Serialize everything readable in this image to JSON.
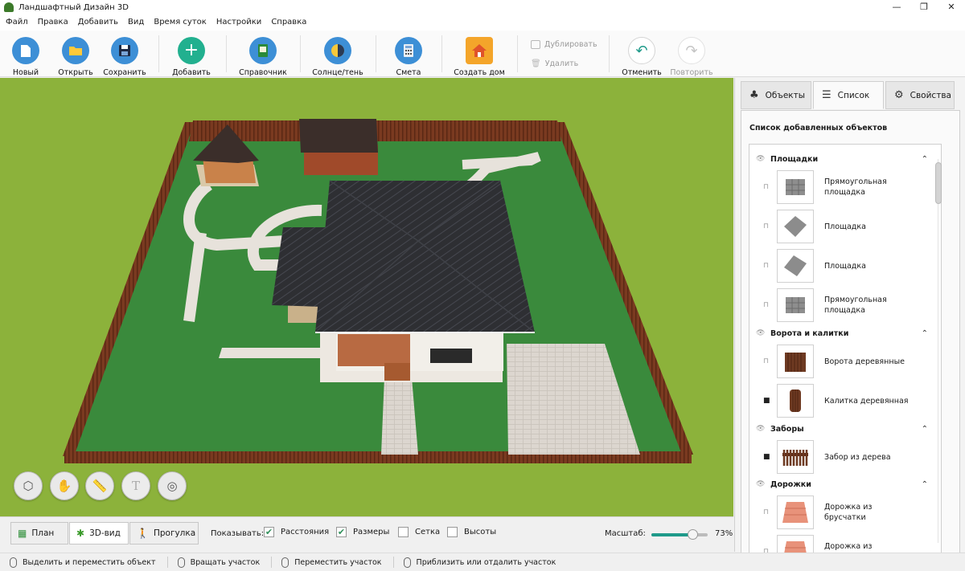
{
  "app": {
    "title": "Ландшафтный Дизайн 3D"
  },
  "window_controls": {
    "minimize": "—",
    "maximize": "❐",
    "close": "✕"
  },
  "menu": [
    "Файл",
    "Правка",
    "Добавить",
    "Вид",
    "Время суток",
    "Настройки",
    "Справка"
  ],
  "toolbar": {
    "new": "Новый",
    "open": "Открыть",
    "save": "Сохранить",
    "add": "Добавить",
    "reference": "Справочник",
    "sun": "Солнце/тень",
    "estimate": "Смета",
    "create_house": "Создать дом",
    "duplicate": "Дублировать",
    "delete": "Удалить",
    "undo": "Отменить",
    "redo": "Повторить"
  },
  "colors": {
    "accent": "#1f9a8a",
    "grass": "#3a8a3c",
    "fence": "#7a3a20",
    "roof": "#2e2f33",
    "path": "#e7e2db",
    "check": "#2f8f5a"
  },
  "view_tools": [
    "move-object-icon",
    "pan-hand-icon",
    "ruler-icon",
    "text-icon",
    "layers-icon"
  ],
  "right_panel": {
    "tabs": [
      {
        "label": "Объекты",
        "icon": "tree-icon"
      },
      {
        "label": "Список",
        "icon": "layers-icon"
      },
      {
        "label": "Свойства",
        "icon": "gear-icon"
      }
    ],
    "active_tab": "Список",
    "list_title": "Список добавленных объектов",
    "groups": [
      {
        "name": "Площадки",
        "items": [
          {
            "name": "Прямоугольная площадка",
            "locked": false
          },
          {
            "name": "Площадка",
            "locked": false
          },
          {
            "name": "Площадка",
            "locked": false
          },
          {
            "name": "Прямоугольная площадка",
            "locked": false
          }
        ]
      },
      {
        "name": "Ворота и калитки",
        "items": [
          {
            "name": "Ворота деревянные",
            "locked": false
          },
          {
            "name": "Калитка деревянная",
            "locked": true
          }
        ]
      },
      {
        "name": "Заборы",
        "items": [
          {
            "name": "Забор из дерева",
            "locked": true
          }
        ]
      },
      {
        "name": "Дорожки",
        "items": [
          {
            "name": "Дорожка из брусчатки",
            "locked": false
          },
          {
            "name": "Дорожка из брусчатки",
            "locked": false
          }
        ]
      }
    ]
  },
  "view_tabs": [
    {
      "label": "План",
      "active": false
    },
    {
      "label": "3D-вид",
      "active": true
    },
    {
      "label": "Прогулка",
      "active": false
    }
  ],
  "show": {
    "label": "Показывать:",
    "options": [
      {
        "label": "Расстояния",
        "checked": true
      },
      {
        "label": "Размеры",
        "checked": true
      },
      {
        "label": "Сетка",
        "checked": false
      },
      {
        "label": "Высоты",
        "checked": false
      }
    ]
  },
  "zoom": {
    "label": "Масштаб:",
    "value": 73,
    "value_text": "73%"
  },
  "status_bar": [
    "Выделить и переместить объект",
    "Вращать участок",
    "Переместить участок",
    "Приблизить или отдалить участок"
  ]
}
